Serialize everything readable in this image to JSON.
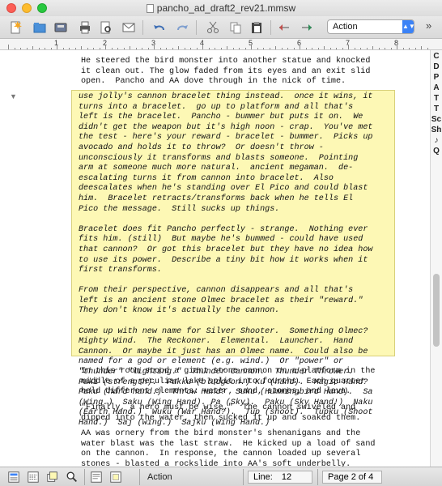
{
  "window": {
    "title": "pancho_ad_draft2_rev21.mmsw"
  },
  "toolbar": {
    "icons": [
      "new-document-icon",
      "open-icon",
      "save-icon",
      "print-icon",
      "print-preview-icon",
      "email-icon",
      "undo-icon",
      "redo-icon",
      "cut-icon",
      "copy-icon",
      "paste-icon",
      "move-up-icon",
      "move-down-icon"
    ],
    "element_select": "Action",
    "more_label": "»"
  },
  "ruler": {
    "numbers": [
      "1",
      "2",
      "3",
      "4",
      "5",
      "6",
      "7",
      "8"
    ]
  },
  "document": {
    "para1": "He steered the bird monster into another statue and knocked\nit clean out. The glow faded from its eyes and an exit slid\nopen.  Pancho and AA dove through in the nick of time.",
    "note_text": "use jolly's cannon bracelet thing instead.  once it wins, it\nturns into a bracelet.  go up to platform and all that's\nleft is the bracelet.  Pancho - bummer but puts it on.  We\ndidn't get the weapon but it's high noon - crap.  You've met\nthe test - here's your reward - bracelet - bummer.  Picks up\navocado and holds it to throw?  Or doesn't throw -\nunconsciously it transforms and blasts someone.  Pointing\narm at someone much more natural.  ancient megaman.  de-\nescalating turns it from cannon into bracelet.  Also\ndeescalates when he's standing over El Pico and could blast\nhim.  Bracelet retracts/transforms back when he tells El\nPico the message.  Still sucks up things.\n\nBracelet does fit Pancho perfectly - strange.  Nothing ever\nfits him. (still)  But maybe he's bummed - could have used\nthat cannon?  Or got this bracelet but they have no idea how\nto use its power.  Describe a tiny bit how it works when it\nfirst transforms.\n\nFrom their perspective, cannon disappears and all that's\nleft is an ancient stone Olmec bracelet as their \"reward.\"\nThey don't know it's actually the cannon.\n\nCome up with new name for Silver Shooter.  Something Olmec?\nMighty Wind.  The Reckoner.  Elemental.  Launcher.  Hand\nCannon.  Or maybe it just has an Olmec name.  Could also be\nnamed for a god or element (e.g. wind.)  Or \"power\" or\n\"thunder\" \"lighting.\"  Thunder Cannon.  Thunder Thrower.\nPaki (strength).  Pakku (bludgeon.) Ku (hand).  Magic Hand?\nPaku (hard hand.)  Throw Hand?  Suku (Hummingbird Hand).  Sa\n(Wing.)  Saku (Wing Hand). Pa (Sky).  Paku (Sky Hand!)  Naku\n(Earth Hand.)  Wuku (War Hand?).  Tup (shoot).  Tupku (Shoot\nHand.)  Saj (wing.)  Sajku (Wing Hand.)",
    "para2": "In this room stood a giant stone cannon on a platform in the\nmiddle of a peculiar lake split into fourths. Each quarter\nheld different elements: water, sand, stones, and lava.",
    "para3": "\"Finally, a hero must be wise.\"  The cannon swiveled and\ndipped into the water, then sucked it up and soaked them.",
    "para4": "AA was ornery from the bird monster's shenanigans and the\nwater blast was the last straw.  He kicked up a load of sand\non the cannon.  In response, the cannon loaded up several\nstones - blasted a rockslide into AA's soft underbelly."
  },
  "sidebar": {
    "letters": [
      "C",
      "D",
      "P",
      "A",
      "T",
      "T",
      "Sc",
      "Sh",
      "♪",
      "Q"
    ]
  },
  "status": {
    "element": "Action",
    "line_label": "Line:",
    "line_value": "12",
    "page": "Page 2 of 4"
  },
  "colors": {
    "note_bg": "#fdf8b5",
    "accent": "#3b82f6"
  }
}
